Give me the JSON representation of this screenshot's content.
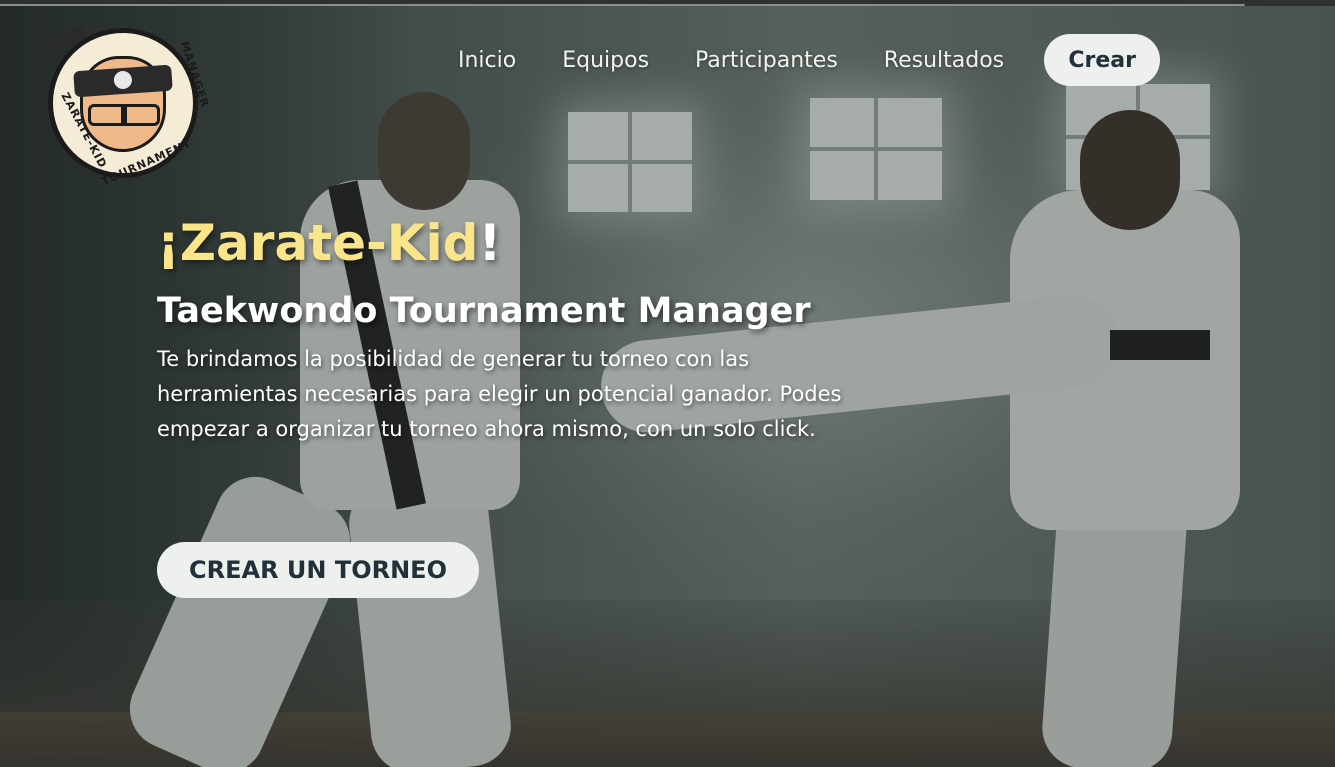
{
  "logo": {
    "text_top": "MANAGER",
    "text_left": "ZARATE-KID",
    "text_bottom": "TOURNAMENT"
  },
  "nav": {
    "items": [
      {
        "label": "Inicio"
      },
      {
        "label": "Equipos"
      },
      {
        "label": "Participantes"
      },
      {
        "label": "Resultados"
      }
    ],
    "cta_label": "Crear"
  },
  "hero": {
    "title_main": "¡Zarate-Kid",
    "title_end": "!",
    "subtitle": "Taekwondo Tournament Manager",
    "description": "Te brindamos la posibilidad de generar tu torneo con las herramientas necesarias para elegir un potencial ganador. Podes empezar a organizar tu torneo ahora mismo, con un solo click.",
    "button_label": "CREAR UN TORNEO"
  },
  "colors": {
    "title_accent": "#fbe58b",
    "button_bg": "#eef0ee",
    "button_text": "#22303a"
  }
}
